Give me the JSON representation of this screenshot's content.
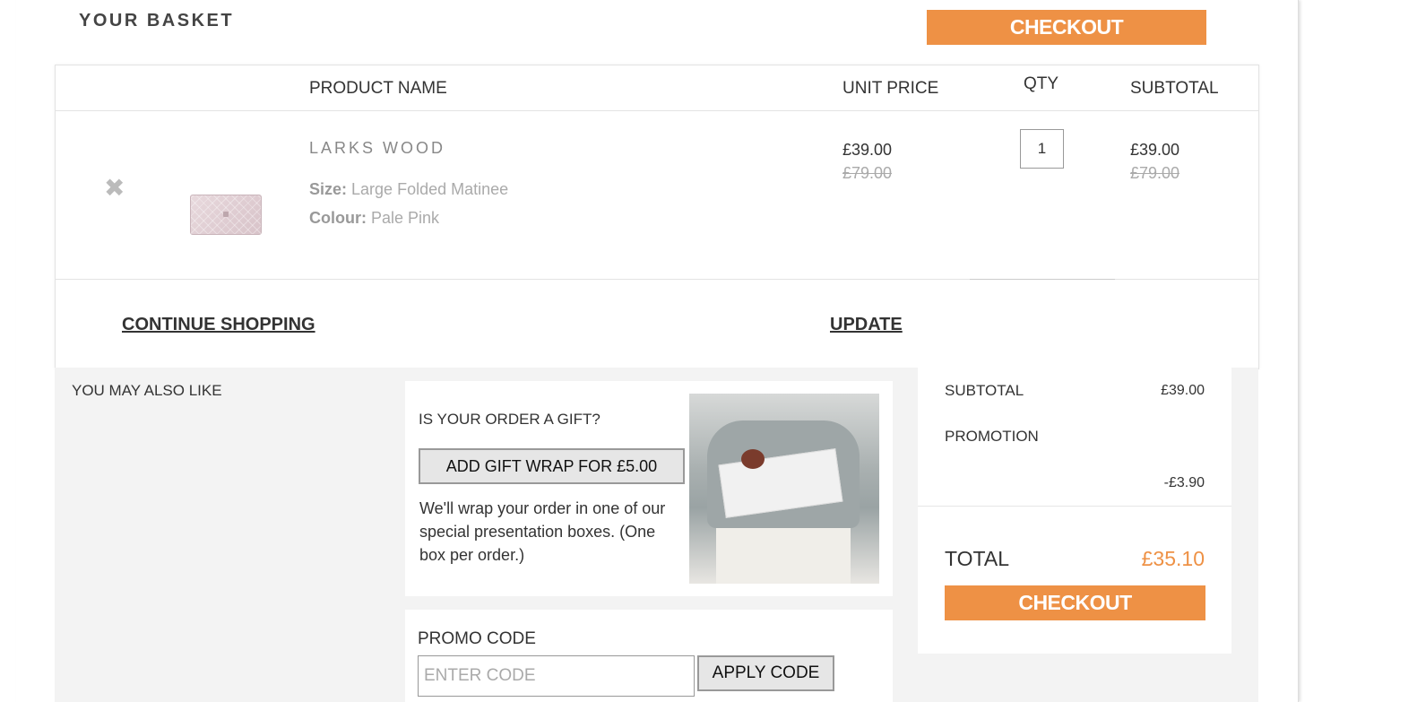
{
  "basket": {
    "title": "YOUR BASKET",
    "checkout_label": "CHECKOUT"
  },
  "table": {
    "headers": {
      "product": "PRODUCT NAME",
      "unit_price": "UNIT PRICE",
      "qty": "QTY",
      "subtotal": "SUBTOTAL"
    },
    "items": [
      {
        "name": "LARKS WOOD",
        "size_label": "Size:",
        "size_value": "Large Folded Matinee",
        "colour_label": "Colour:",
        "colour_value": "Pale Pink",
        "unit_price": "£39.00",
        "unit_price_was": "£79.00",
        "qty": "1",
        "subtotal": "£39.00",
        "subtotal_was": "£79.00"
      }
    ],
    "continue_label": "CONTINUE SHOPPING",
    "update_label": "UPDATE"
  },
  "recommendations": {
    "title": "YOU MAY ALSO LIKE"
  },
  "gift": {
    "question": "IS YOUR ORDER A GIFT?",
    "button_label": "ADD GIFT WRAP FOR £5.00",
    "description": "We'll wrap your order in one of our special presentation boxes. (One box per order.)"
  },
  "promo": {
    "label": "PROMO CODE",
    "placeholder": "ENTER CODE",
    "value": "",
    "button_label": "APPLY CODE"
  },
  "summary": {
    "subtotal_label": "SUBTOTAL",
    "subtotal_value": "£39.00",
    "promotion_label": "PROMOTION",
    "promotion_value": "-£3.90",
    "total_label": "TOTAL",
    "total_value": "£35.10",
    "checkout_label": "CHECKOUT"
  },
  "colors": {
    "accent": "#ee9145",
    "panel_bg": "#f3f3f3"
  }
}
